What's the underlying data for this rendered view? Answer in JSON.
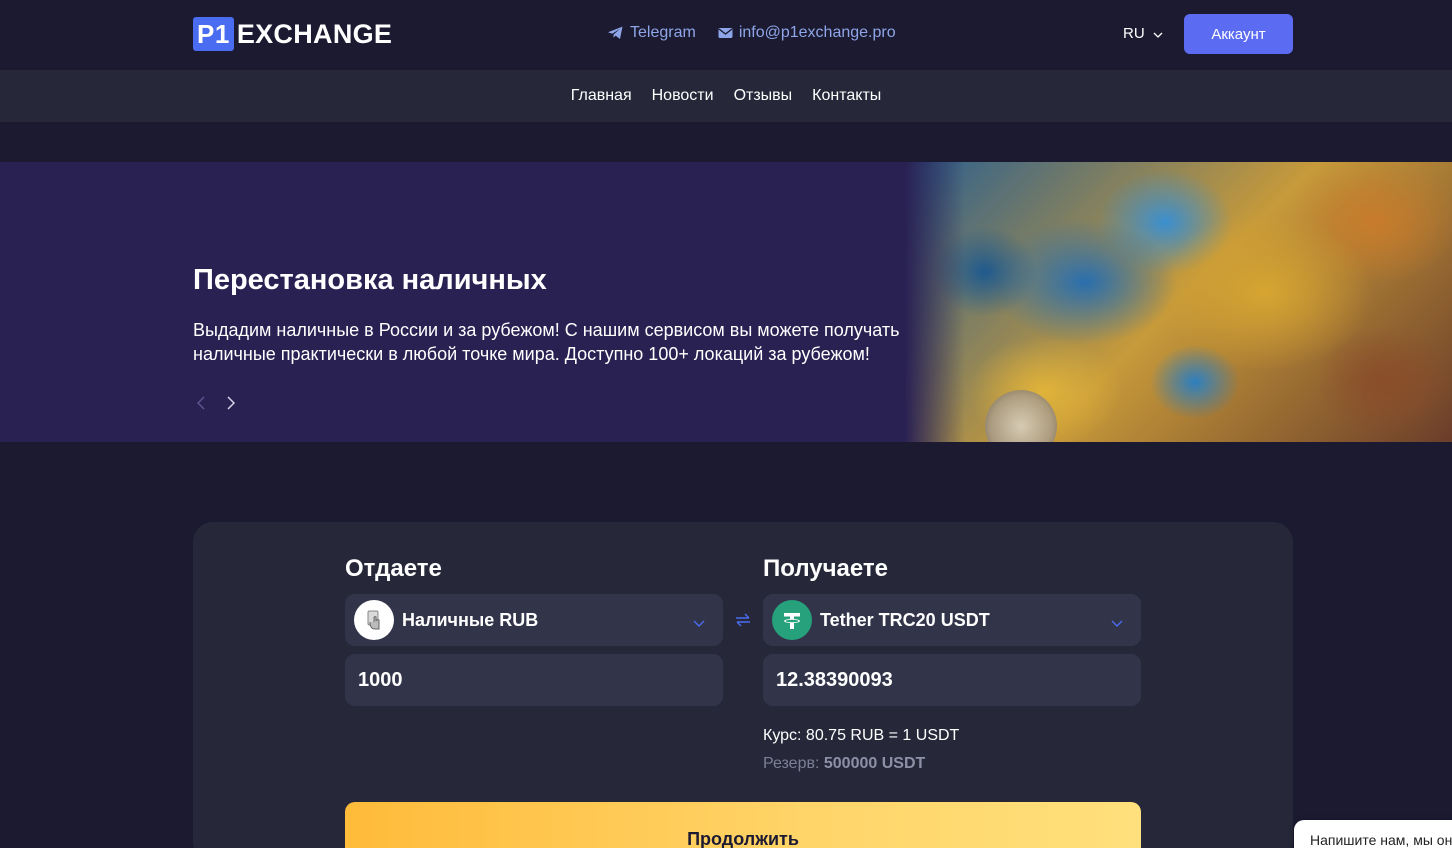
{
  "header": {
    "logo_badge": "P1",
    "logo_text": "EXCHANGE",
    "telegram_label": "Telegram",
    "email_label": "info@p1exchange.pro",
    "language": "RU",
    "account_button": "Аккаунт"
  },
  "nav": {
    "items": [
      "Главная",
      "Новости",
      "Отзывы",
      "Контакты"
    ]
  },
  "hero": {
    "title": "Перестановка наличных",
    "description": "Выдадим наличные в России и за рубежом! С нашим сервисом вы можете получать наличные практически в любой точке мира. Доступно 100+ локаций за рубежом!"
  },
  "exchange": {
    "give_title": "Отдаете",
    "give_currency": "Наличные RUB",
    "give_amount": "1000",
    "get_title": "Получаете",
    "get_currency": "Tether TRC20 USDT",
    "get_amount": "12.38390093",
    "rate": "Курс: 80.75 RUB = 1 USDT",
    "reserve_label": "Резерв:",
    "reserve_value": "500000 USDT",
    "continue_button": "Продолжить"
  },
  "chat_widget": {
    "text": "Напишите нам, мы он"
  },
  "colors": {
    "background": "#1b1a30",
    "accent": "#5b6cf2",
    "hero_bg": "#2a2153",
    "card_bg": "#262839",
    "usdt": "#26a17b",
    "continue_gradient_start": "#ffbb3a"
  },
  "icons": {
    "telegram": "telegram-icon",
    "email": "email-icon",
    "lang_chevron": "chevron-down-icon",
    "swap": "swap-arrows-icon",
    "cash": "cash-hand-icon",
    "usdt": "tether-icon"
  }
}
